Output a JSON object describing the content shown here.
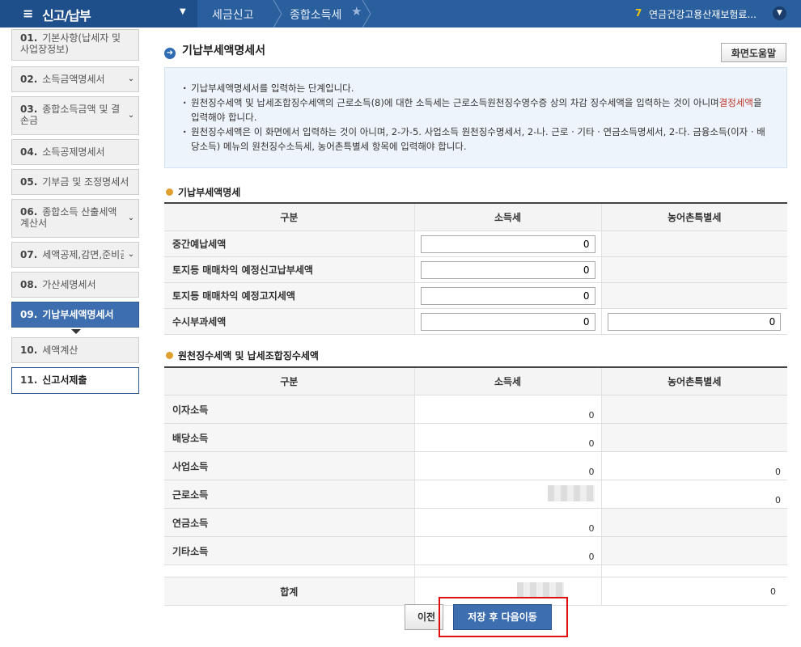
{
  "topbar": {
    "menu_title": "신고/납부",
    "breadcrumbs": [
      "세금신고",
      "종합소득세"
    ],
    "notice_count": "7",
    "notice_text": "연금건강고용산재보험료..."
  },
  "sidebar": {
    "items": [
      {
        "num": "01.",
        "label": "기본사항(납세자 및 사업장정보)"
      },
      {
        "num": "02.",
        "label": "소득금액명세서"
      },
      {
        "num": "03.",
        "label": "종합소득금액 및 결손금"
      },
      {
        "num": "04.",
        "label": "소득공제명세서"
      },
      {
        "num": "05.",
        "label": "기부금 및 조정명세서"
      },
      {
        "num": "06.",
        "label": "종합소득 산출세액계산서"
      },
      {
        "num": "07.",
        "label": "세액공제,감면,준비금"
      },
      {
        "num": "08.",
        "label": "가산세명세서"
      },
      {
        "num": "09.",
        "label": "기납부세액명세서"
      },
      {
        "num": "10.",
        "label": "세액계산"
      },
      {
        "num": "11.",
        "label": "신고서제출"
      }
    ]
  },
  "page": {
    "title": "기납부세액명세서",
    "help_button": "화면도움말",
    "info": [
      "기납부세액명세서를 입력하는 단계입니다.",
      "원천징수세액 및 납세조합징수세액의 근로소득(8)에 대한 소득세는 근로소득원천징수영수증 상의 차감 징수세액을 입력하는 것이 아니며",
      "결정세액",
      "을 입력해야 합니다.",
      "원천징수세액은 이 화면에서 입력하는 것이 아니며, 2-가-5. 사업소득 원천징수명세서, 2-나. 근로 · 기타 · 연금소득명세서, 2-다. 금융소득(이자 · 배당소득) 메뉴의 원천징수소득세, 농어촌특별세 항목에 입력해야 합니다."
    ]
  },
  "section1": {
    "title": "기납부세액명세",
    "headers": [
      "구분",
      "소득세",
      "농어촌특별세"
    ],
    "rows": [
      {
        "label": "중간예납세액",
        "income_tax": "0"
      },
      {
        "label": "토지등 매매차익 예정신고납부세액",
        "income_tax": "0"
      },
      {
        "label": "토지등 매매차익 예정고지세액",
        "income_tax": "0"
      },
      {
        "label": "수시부과세액",
        "income_tax": "0",
        "rural_tax": "0"
      }
    ]
  },
  "section2": {
    "title": "원천징수세액 및 납세조합징수세액",
    "headers": [
      "구분",
      "소득세",
      "농어촌특별세"
    ],
    "rows": [
      {
        "label": "이자소득",
        "income_tax": "0",
        "rural_tax": ""
      },
      {
        "label": "배당소득",
        "income_tax": "0",
        "rural_tax": ""
      },
      {
        "label": "사업소득",
        "income_tax": "0",
        "rural_tax": "0"
      },
      {
        "label": "근로소득",
        "income_tax": "",
        "rural_tax": "0"
      },
      {
        "label": "연금소득",
        "income_tax": "0",
        "rural_tax": ""
      },
      {
        "label": "기타소득",
        "income_tax": "0",
        "rural_tax": ""
      }
    ],
    "total_label": "합계",
    "total_rural": "0"
  },
  "buttons": {
    "prev": "이전",
    "save_next": "저장 후 다음이동"
  },
  "colors": {
    "accent": "#3d6eb0",
    "topbar": "#2a5f9e",
    "highlight": "#e01010"
  }
}
